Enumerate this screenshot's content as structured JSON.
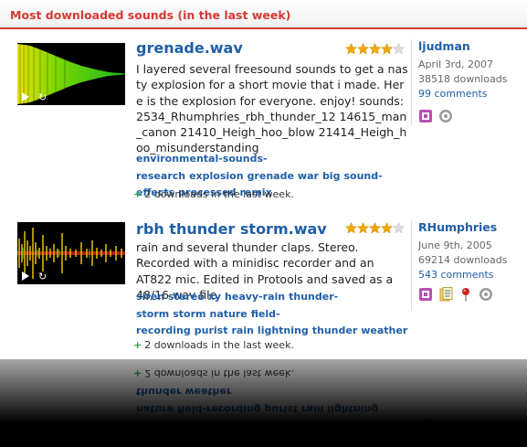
{
  "panel_title": "Most downloaded sounds (in the last week)",
  "sounds": [
    {
      "title": "grenade.wav",
      "rating": 4,
      "rating_max": 5,
      "description": "I layered several freesound sounds to get a nasty explosion for a short movie that i made. Here is the explosion for everyone. enjoy! sounds: 2534_Rhumphries_rbh_thunder_12 14615_man_canon 21410_Heigh_hoo_blow 21414_Heigh_hoo_misunderstanding",
      "tags": [
        "environmental-sounds-research",
        "explosion",
        "grenade",
        "war",
        "big",
        "sound-effects",
        "processed",
        "remix"
      ],
      "downloads_week": "2 downloads in the last week.",
      "user": "ljudman",
      "date": "April 3rd, 2007",
      "downloads": "38518 downloads",
      "comments": "99 comments",
      "icons": [
        "license-icon",
        "info-icon"
      ],
      "wave_color": "#38c800"
    },
    {
      "title": "rbh thunder storm.wav",
      "rating": 4,
      "rating_max": 5,
      "description": "rain and several thunder claps. Stereo. Recorded with a minidisc recorder and an AT822 mic. Edited in Protools and saved as a 48/16 wav file.",
      "tags": [
        "siren",
        "stereo",
        "xy",
        "heavy-rain",
        "thunder-storm",
        "storm",
        "nature",
        "field-recording",
        "purist",
        "rain",
        "lightning",
        "thunder",
        "weather"
      ],
      "downloads_week": "2 downloads in the last week.",
      "user": "RHumphries",
      "date": "June 9th, 2005",
      "downloads": "69214 downloads",
      "comments": "543 comments",
      "icons": [
        "license-icon",
        "document-icon",
        "geotag-pin-icon",
        "info-icon"
      ],
      "wave_color": "#d2b400"
    }
  ],
  "colors": {
    "accent": "#d23a36",
    "link": "#1f5fa8",
    "star": "#f0a800",
    "plus": "#2da84a"
  }
}
